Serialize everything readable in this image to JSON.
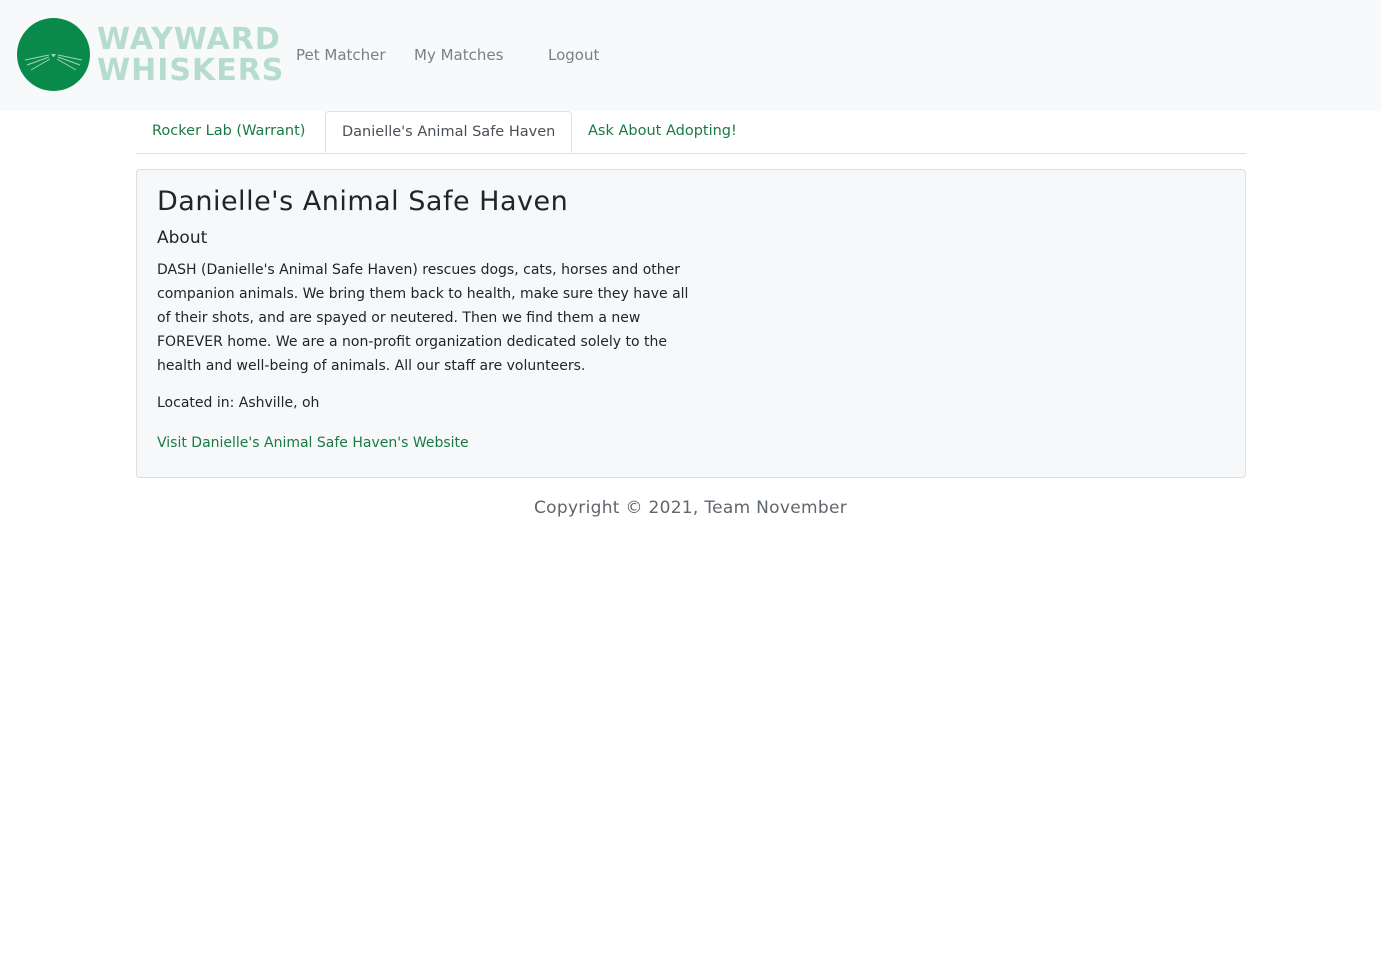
{
  "brand": {
    "line1": "WAYWARD",
    "line2": "WHISKERS",
    "logo_icon": "cat-whiskers-logo",
    "logo_color": "#0a8a4a",
    "text_color": "#b5dccd"
  },
  "nav": {
    "items": [
      {
        "label": "Pet Matcher"
      },
      {
        "label": "My Matches"
      },
      {
        "label": "Logout"
      }
    ]
  },
  "tabs": [
    {
      "label": "Rocker Lab (Warrant)",
      "active": false
    },
    {
      "label": "Danielle's Animal Safe Haven",
      "active": true
    },
    {
      "label": "Ask About Adopting!",
      "active": false
    }
  ],
  "shelter": {
    "name": "Danielle's Animal Safe Haven",
    "about_heading": "About",
    "about_text": "DASH (Danielle's Animal Safe Haven) rescues dogs, cats, horses and other companion animals. We bring them back to health, make sure they have all of their shots, and are spayed or neutered. Then we find them a new FOREVER home. We are a non-profit organization dedicated solely to the health and well-being of animals. All our staff are volunteers.",
    "location": "Located in: Ashville, oh",
    "website_link": "Visit Danielle's Animal Safe Haven's Website"
  },
  "footer": {
    "copyright": "Copyright © 2021, Team November"
  },
  "colors": {
    "link": "#1b7a43",
    "navbar_bg": "#f8f9fa",
    "nav_text": "#7b7f83"
  }
}
